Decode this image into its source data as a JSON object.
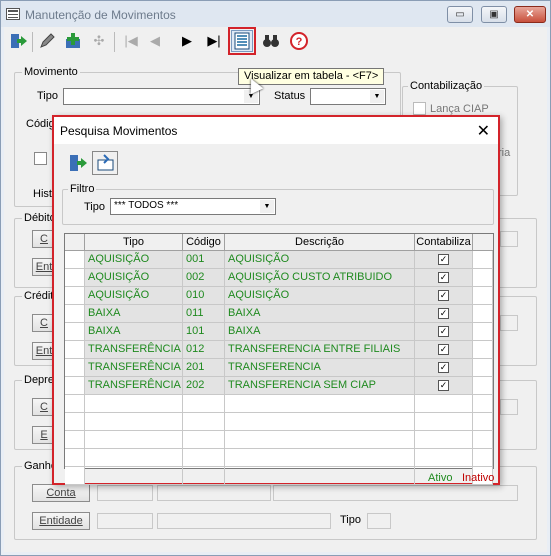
{
  "window": {
    "title": "Manutenção de Movimentos",
    "minimize": "▭",
    "restore": "▣",
    "close": "✕"
  },
  "toolbar": {
    "tooltip": "Visualizar em tabela - <F7>"
  },
  "main": {
    "movimento": "Movimento",
    "tipo": "Tipo",
    "status": "Status",
    "codigo": "Códig",
    "contabilizacao": "Contabilização",
    "lanca_ciap": "Lança CIAP",
    "ria": "ria",
    "historico": "Histo",
    "debito": "Débito",
    "credito": "Crédito",
    "depre": "Depre",
    "ganho": "Ganho",
    "conta": "Conta",
    "entidade": "Entidade",
    "tipo2": "Tipo",
    "c": "C",
    "ent": "Ent",
    "e": "E"
  },
  "dialog": {
    "title": "Pesquisa Movimentos",
    "close": "✕",
    "filtro": "Filtro",
    "tipo_label": "Tipo",
    "tipo_value": "*** TODOS ***",
    "columns": [
      "Tipo",
      "Código",
      "Descrição",
      "Contabiliza"
    ],
    "rows": [
      {
        "tipo": "AQUISIÇÃO",
        "codigo": "001",
        "descricao": "AQUISIÇÃO",
        "check": "✓"
      },
      {
        "tipo": "AQUISIÇÃO",
        "codigo": "002",
        "descricao": "AQUISIÇÃO CUSTO ATRIBUIDO",
        "check": "✓"
      },
      {
        "tipo": "AQUISIÇÃO",
        "codigo": "010",
        "descricao": "AQUISIÇÃO",
        "check": "✓"
      },
      {
        "tipo": "BAIXA",
        "codigo": "011",
        "descricao": "BAIXA",
        "check": "✓"
      },
      {
        "tipo": "BAIXA",
        "codigo": "101",
        "descricao": "BAIXA",
        "check": "✓"
      },
      {
        "tipo": "TRANSFERÊNCIA",
        "codigo": "012",
        "descricao": "TRANSFERENCIA ENTRE FILIAIS",
        "check": "✓"
      },
      {
        "tipo": "TRANSFERÊNCIA",
        "codigo": "201",
        "descricao": "TRANSFERENCIA",
        "check": "✓"
      },
      {
        "tipo": "TRANSFERÊNCIA",
        "codigo": "202",
        "descricao": "TRANSFERENCIA SEM CIAP",
        "check": "✓"
      }
    ],
    "ativo": "Ativo",
    "inativo": "Inativo"
  },
  "colors": {
    "accent_red": "#d3232a",
    "active_green": "#1f8a1f",
    "inactive_red": "#c00000"
  }
}
